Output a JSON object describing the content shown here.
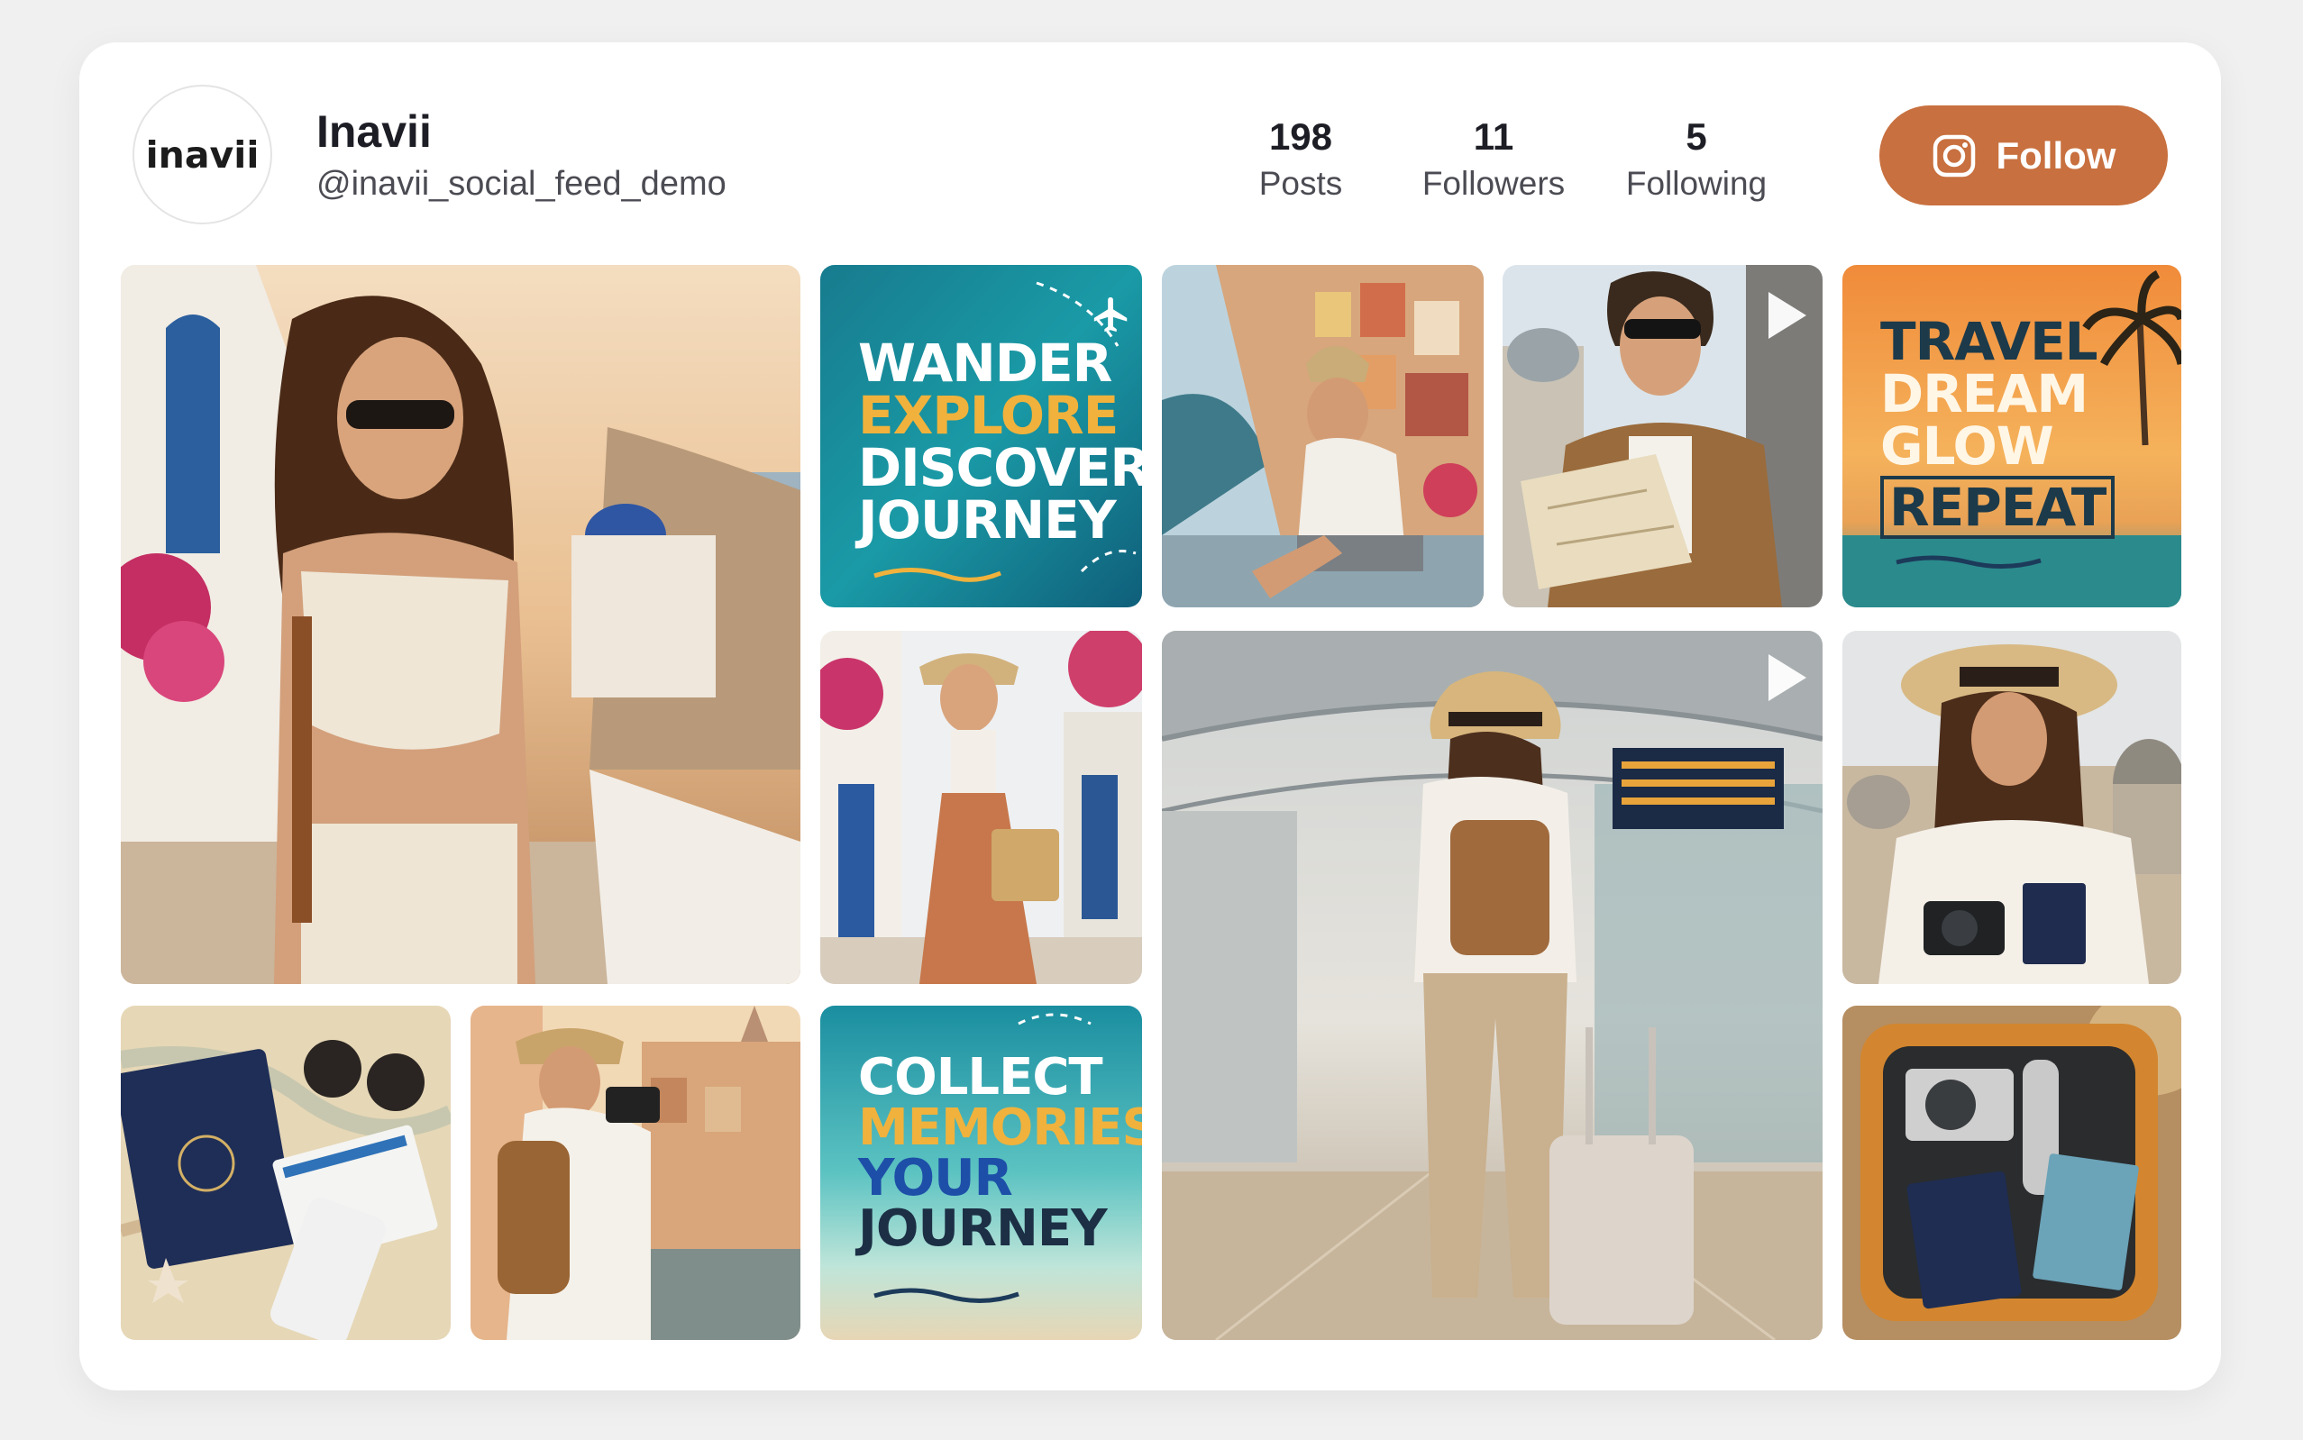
{
  "profile": {
    "avatar_text": "inavii",
    "name": "Inavii",
    "handle": "@inavii_social_feed_demo"
  },
  "stats": [
    {
      "value": "198",
      "label": "Posts"
    },
    {
      "value": "11",
      "label": "Followers"
    },
    {
      "value": "5",
      "label": "Following"
    }
  ],
  "follow_button": {
    "label": "Follow",
    "icon": "instagram-icon"
  },
  "quotes": {
    "q1": [
      "WANDER",
      "EXPLORE",
      "DISCOVER",
      "JOURNEY"
    ],
    "q2": [
      "TRAVEL",
      "DREAM",
      "GLOW",
      "REPEAT"
    ],
    "q3": [
      "COLLECT",
      "MEMORIES",
      "YOUR",
      "JOURNEY"
    ]
  },
  "colors": {
    "accent": "#c8703f",
    "background": "#f0f0f0",
    "card": "#ffffff",
    "quote_gold": "#f0b23c",
    "quote_navy": "#1c3a5a"
  }
}
